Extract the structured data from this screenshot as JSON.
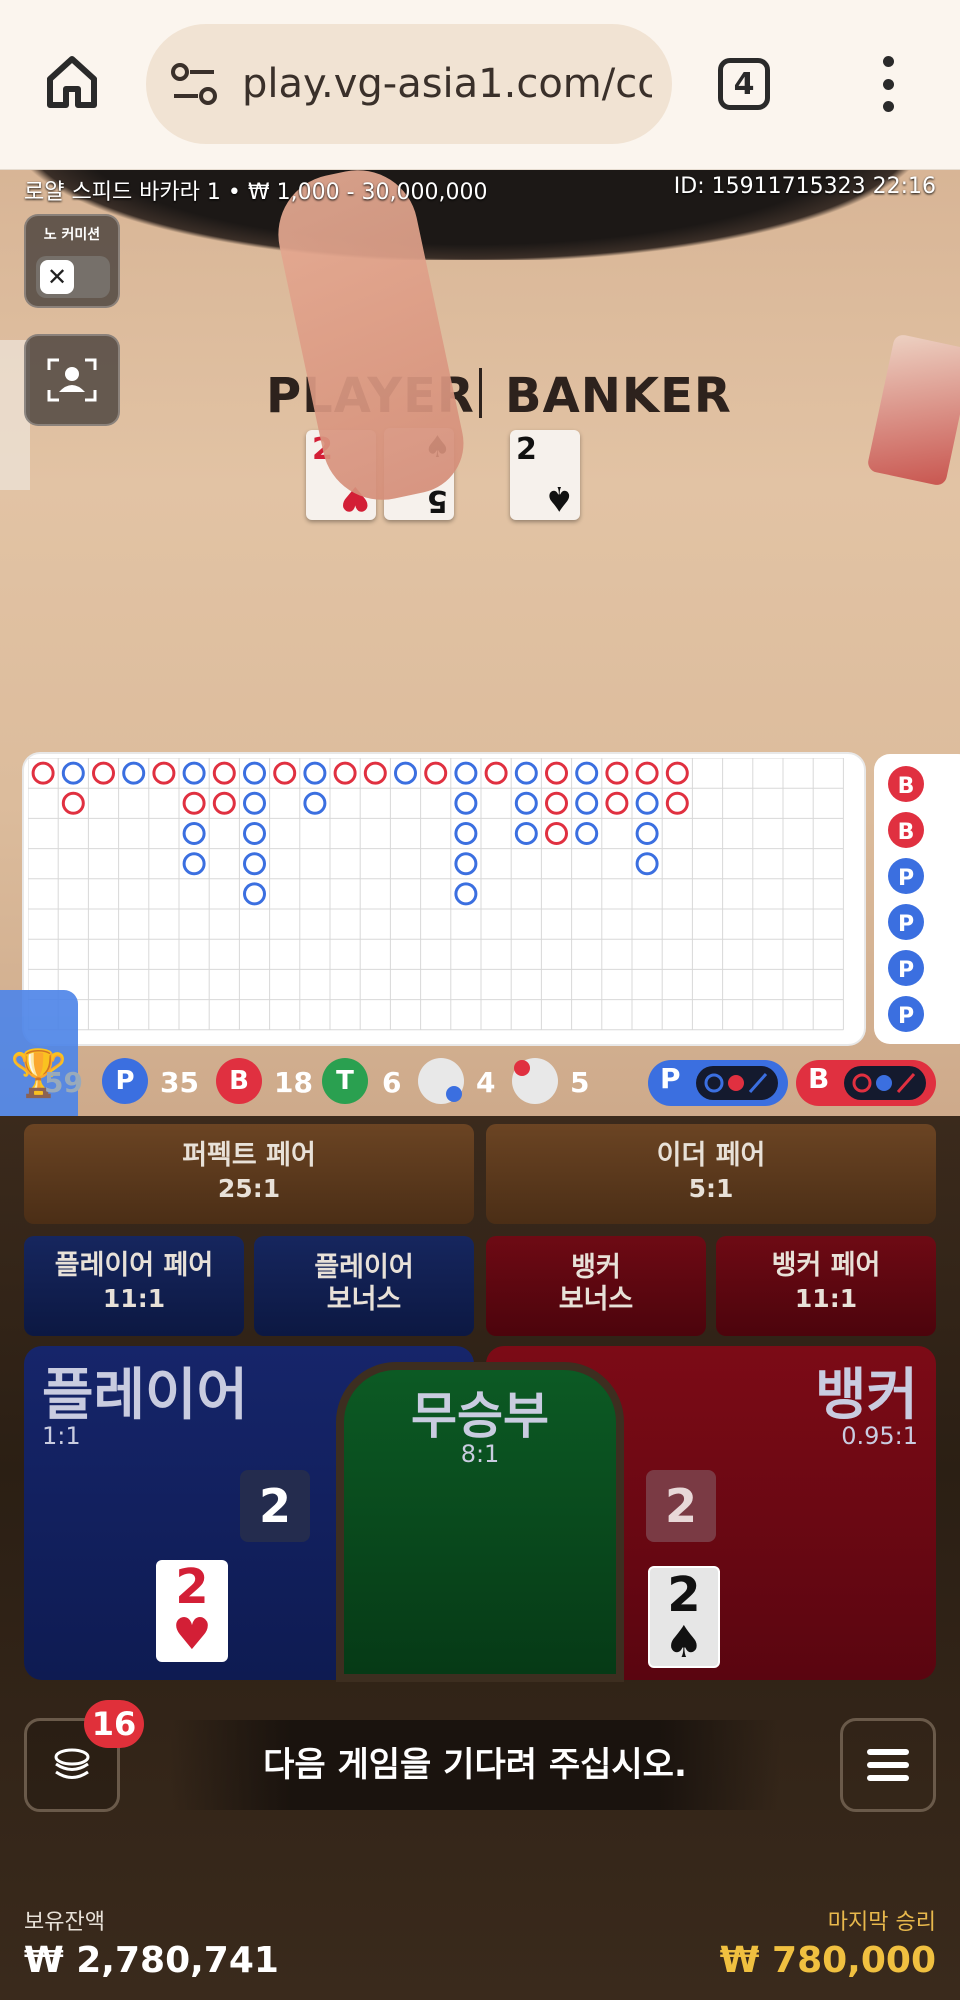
{
  "browser": {
    "url": "play.vg-asia1.com/cc",
    "tab_count": "4",
    "home_icon": "home-icon",
    "site_settings_icon": "tune-icon",
    "menu_icon": "kebab-icon"
  },
  "game": {
    "info": "로얄 스피드 바카라 1 • ₩ 1,000 - 30,000,000",
    "id": "ID: 15911715323 22:16",
    "no_commission_label": "노 커미션",
    "no_commission_state": "off",
    "felt_player": "PLAYER",
    "felt_banker": "BANKER"
  },
  "table_cards": [
    {
      "rank": "2",
      "suit": "♥",
      "color": "#d31f36"
    },
    {
      "rank": "5",
      "suit": "♠",
      "color": "#111111"
    },
    {
      "rank": "2",
      "suit": "♠",
      "color": "#111111"
    }
  ],
  "stats": {
    "total": "59",
    "player": "35",
    "banker": "18",
    "tie": "6",
    "player_pair": "4",
    "banker_pair": "5",
    "player_predict": "P",
    "banker_predict": "B"
  },
  "side_bets": {
    "perfect_pair": {
      "label": "퍼펙트 페어",
      "odds": "25:1"
    },
    "either_pair": {
      "label": "이더 페어",
      "odds": "5:1"
    },
    "player_pair": {
      "label": "플레이어 페어",
      "odds": "11:1"
    },
    "player_bonus": {
      "label1": "플레이어",
      "label2": "보너스"
    },
    "banker_bonus": {
      "label1": "뱅커",
      "label2": "보너스"
    },
    "banker_pair": {
      "label": "뱅커 페어",
      "odds": "11:1"
    }
  },
  "main_bets": {
    "player": {
      "label": "플레이어",
      "odds": "1:1",
      "score": "2",
      "card_rank": "2",
      "card_suit": "♥"
    },
    "tie": {
      "label": "무승부",
      "odds": "8:1"
    },
    "banker": {
      "label": "뱅커",
      "odds": "0.95:1",
      "score": "2",
      "card_rank": "2",
      "card_suit": "♠"
    }
  },
  "bottom": {
    "chip_count": "16",
    "message": "다음 게임을 기다려 주십시오.",
    "balance_label": "보유잔액",
    "balance_value": "₩ 2,780,741",
    "last_win_label": "마지막 승리",
    "last_win_value": "₩ 780,000"
  },
  "colors": {
    "player": "#3b6fe0",
    "banker": "#e03040",
    "tie": "#2aa050"
  },
  "roadmap": {
    "big_road": [
      [
        "B"
      ],
      [
        "P",
        "B"
      ],
      [
        "B"
      ],
      [
        "P"
      ],
      [
        "B"
      ],
      [
        "P",
        "B",
        "P",
        "P"
      ],
      [
        "B",
        "B"
      ],
      [
        "P",
        "P",
        "P",
        "P",
        "P"
      ],
      [
        "B"
      ],
      [
        "P",
        "P"
      ],
      [
        "B"
      ],
      [
        "B"
      ],
      [
        "P"
      ],
      [
        "B"
      ],
      [
        "P",
        "P",
        "P",
        "P",
        "P"
      ],
      [
        "B"
      ],
      [
        "P",
        "P",
        "P"
      ],
      [
        "B",
        "B",
        "B"
      ],
      [
        "P",
        "P",
        "P"
      ],
      [
        "B",
        "B"
      ],
      [
        "B",
        "P",
        "P",
        "P"
      ],
      [
        "B",
        "B"
      ]
    ],
    "bead_plate": [
      "B",
      "B",
      "P",
      "P",
      "P",
      "P"
    ]
  }
}
